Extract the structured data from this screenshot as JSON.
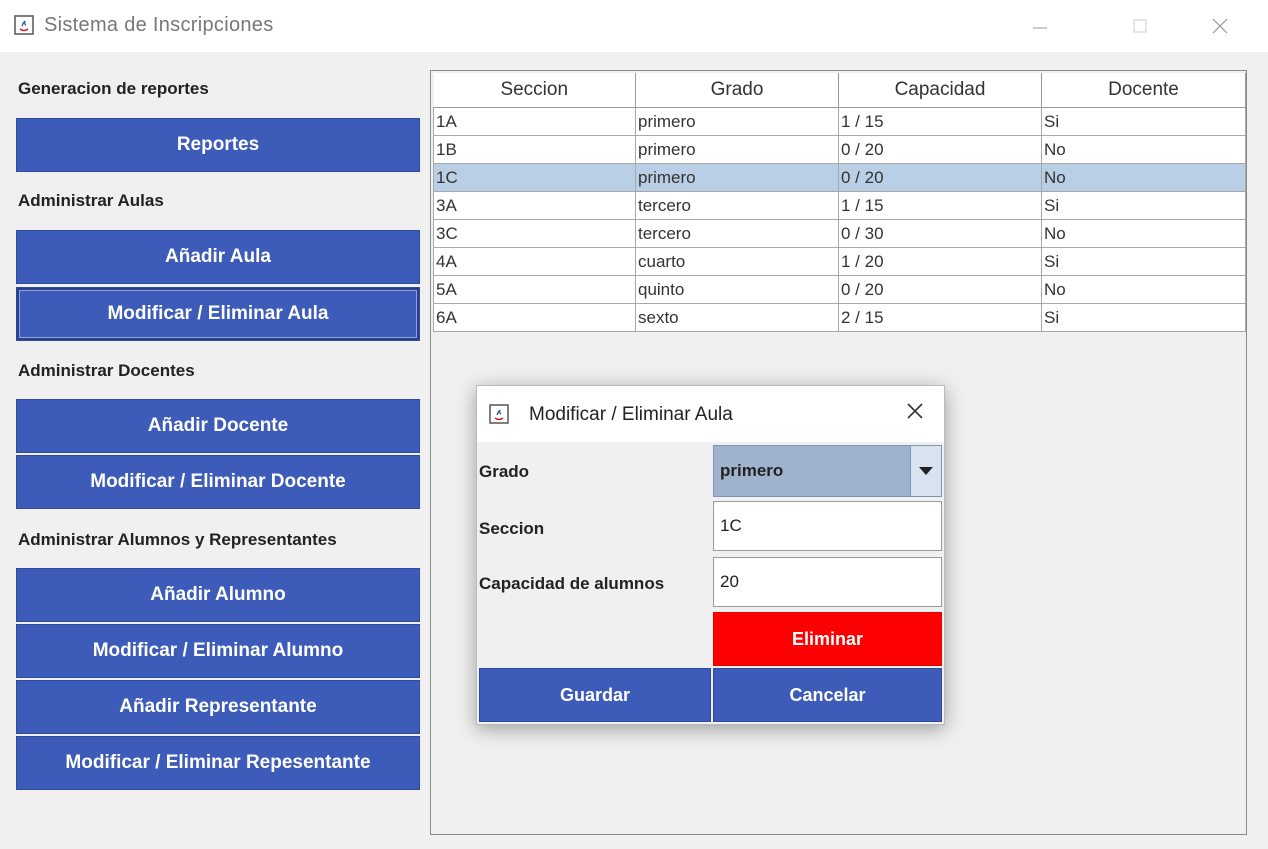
{
  "window": {
    "title": "Sistema de Inscripciones"
  },
  "sidebar": {
    "sections": [
      {
        "label": "Generacion de reportes",
        "buttons": [
          "Reportes"
        ]
      },
      {
        "label": "Administrar Aulas",
        "buttons": [
          "Añadir Aula",
          "Modificar / Eliminar Aula"
        ]
      },
      {
        "label": "Administrar Docentes",
        "buttons": [
          "Añadir Docente",
          "Modificar / Eliminar Docente"
        ]
      },
      {
        "label": "Administrar Alumnos y Representantes",
        "buttons": [
          "Añadir Alumno",
          "Modificar / Eliminar Alumno",
          "Añadir Representante",
          "Modificar / Eliminar Repesentante"
        ]
      }
    ]
  },
  "table": {
    "headers": [
      "Seccion",
      "Grado",
      "Capacidad",
      "Docente"
    ],
    "rows": [
      [
        "1A",
        "primero",
        "1 / 15",
        "Si"
      ],
      [
        "1B",
        "primero",
        "0 / 20",
        "No"
      ],
      [
        "1C",
        "primero",
        "0 / 20",
        "No"
      ],
      [
        "3A",
        "tercero",
        "1 / 15",
        "Si"
      ],
      [
        "3C",
        "tercero",
        "0 / 30",
        "No"
      ],
      [
        "4A",
        "cuarto",
        "1 / 20",
        "Si"
      ],
      [
        "5A",
        "quinto",
        "0 / 20",
        "No"
      ],
      [
        "6A",
        "sexto",
        "2 / 15",
        "Si"
      ]
    ],
    "selected_row": 2
  },
  "dialog": {
    "title": "Modificar / Eliminar Aula",
    "grado_label": "Grado",
    "grado_value": "primero",
    "seccion_label": "Seccion",
    "seccion_value": "1C",
    "capacidad_label": "Capacidad de alumnos",
    "capacidad_value": "20",
    "delete_label": "Eliminar",
    "save_label": "Guardar",
    "cancel_label": "Cancelar"
  },
  "colors": {
    "button_blue": "#3d5bb8",
    "delete_red": "#ff0000",
    "selected_row": "#b8cfe5"
  }
}
